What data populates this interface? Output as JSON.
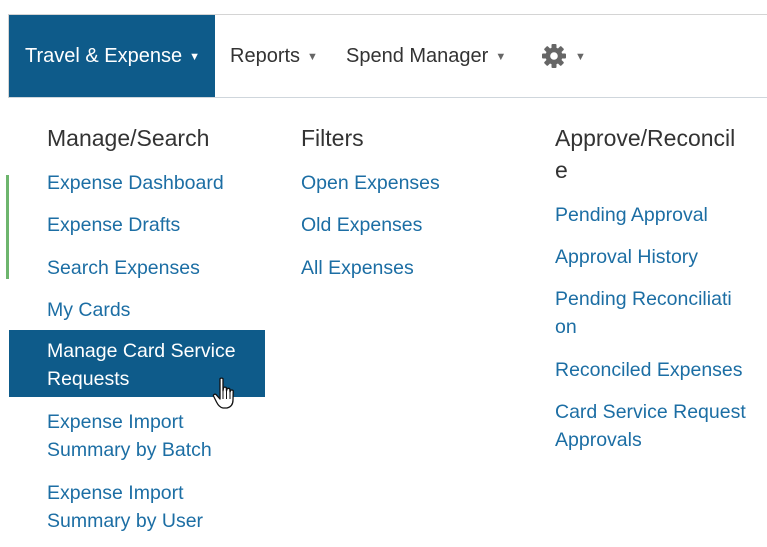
{
  "nav": {
    "items": [
      {
        "label": "Travel & Expense",
        "active": true
      },
      {
        "label": "Reports",
        "active": false
      },
      {
        "label": "Spend Manager",
        "active": false
      }
    ],
    "settings_icon": "gear-icon",
    "caret_icon": "caret-down-icon"
  },
  "menu": {
    "manage": {
      "heading": "Manage/Search",
      "links": [
        "Expense Dashboard",
        "Expense Drafts",
        "Search Expenses",
        "My Cards",
        "Manage Card Service Requests",
        "Expense Import Summary by Batch",
        "Expense Import Summary by User"
      ],
      "highlighted_index": 4
    },
    "filters": {
      "heading": "Filters",
      "links": [
        "Open Expenses",
        "Old Expenses",
        "All Expenses"
      ]
    },
    "approve": {
      "heading": "Approve/Reconcile",
      "links": [
        "Pending Approval",
        "Approval History",
        "Pending Reconciliation",
        "Reconciled Expenses",
        "Card Service Request Approvals"
      ]
    }
  },
  "colors": {
    "active_bg": "#0e5b8a",
    "link": "#1c6ea4",
    "heading": "#333333"
  },
  "cursor": "hand-pointer-icon"
}
